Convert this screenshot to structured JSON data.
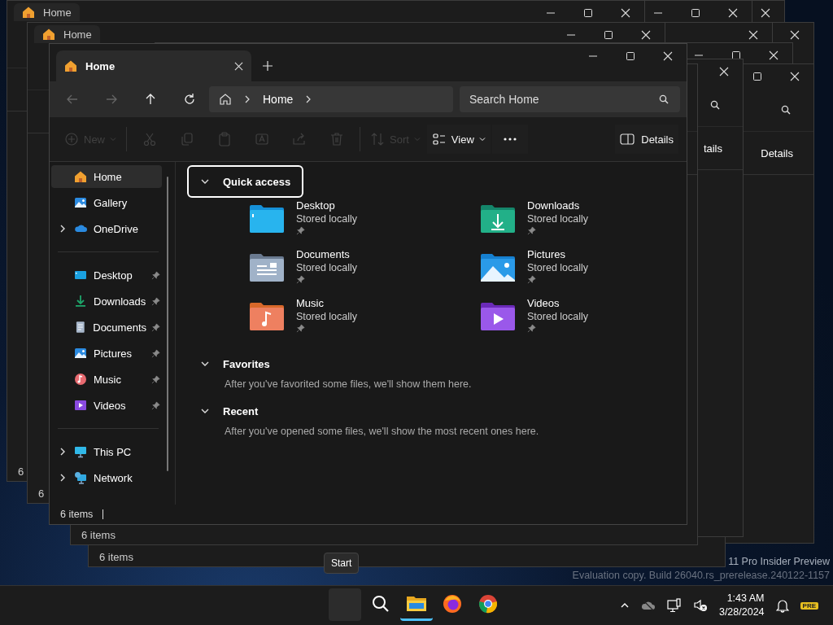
{
  "desktop": {
    "edition_text": "11 Pro Insider Preview",
    "build_text": "Evaluation copy. Build 26040.rs_prerelease.240122-1157"
  },
  "background_windows": [
    {
      "tab_title": "Home",
      "status": "6"
    },
    {
      "tab_title": "Home",
      "status": "6"
    },
    {
      "details": "Details"
    },
    {
      "details": "tails"
    },
    {
      "status": "6 items"
    },
    {
      "status": "6 items"
    }
  ],
  "window": {
    "tab_title": "Home",
    "nav": [
      {
        "kind": "back",
        "disabled": true
      },
      {
        "kind": "forward",
        "disabled": true
      },
      {
        "kind": "up",
        "disabled": false
      },
      {
        "kind": "refresh",
        "disabled": false
      }
    ],
    "address": [
      "Home"
    ],
    "search": {
      "placeholder": "Search Home"
    },
    "commands": [
      {
        "kind": "new",
        "label": "New",
        "disabled": true
      },
      {
        "kind": "cut",
        "disabled": true
      },
      {
        "kind": "copy",
        "disabled": true
      },
      {
        "kind": "paste",
        "disabled": true
      },
      {
        "kind": "rename",
        "disabled": true
      },
      {
        "kind": "share",
        "disabled": true
      },
      {
        "kind": "delete",
        "disabled": true
      },
      {
        "kind": "sort",
        "label": "Sort",
        "disabled": true
      },
      {
        "kind": "view",
        "label": "View",
        "disabled": false
      },
      {
        "kind": "more",
        "disabled": false
      }
    ],
    "details_button": "Details",
    "sidebar": [
      [
        {
          "kind": "home",
          "label": "Home",
          "selected": true
        },
        {
          "kind": "gallery",
          "label": "Gallery",
          "selected": false
        },
        {
          "kind": "onedrive",
          "label": "OneDrive",
          "selected": false,
          "expanded": false
        }
      ],
      [
        {
          "kind": "desktop",
          "label": "Desktop",
          "selected": false,
          "pinned": true
        },
        {
          "kind": "downloads",
          "label": "Downloads",
          "selected": false,
          "pinned": true
        },
        {
          "kind": "documents",
          "label": "Documents",
          "selected": false,
          "pinned": true
        },
        {
          "kind": "pictures",
          "label": "Pictures",
          "selected": false,
          "pinned": true
        },
        {
          "kind": "music",
          "label": "Music",
          "selected": false,
          "pinned": true
        },
        {
          "kind": "videos",
          "label": "Videos",
          "selected": false,
          "pinned": true
        }
      ],
      [
        {
          "kind": "thispc",
          "label": "This PC",
          "selected": false,
          "expanded": false
        },
        {
          "kind": "network",
          "label": "Network",
          "selected": false,
          "expanded": false
        }
      ]
    ],
    "quick_access": {
      "title": "Quick access",
      "expanded": true,
      "focused": true,
      "items": [
        {
          "kind": "desktop",
          "name": "Desktop",
          "location": "Stored locally",
          "pinned": true
        },
        {
          "kind": "downloads",
          "name": "Downloads",
          "location": "Stored locally",
          "pinned": true
        },
        {
          "kind": "documents",
          "name": "Documents",
          "location": "Stored locally",
          "pinned": true
        },
        {
          "kind": "pictures",
          "name": "Pictures",
          "location": "Stored locally",
          "pinned": true
        },
        {
          "kind": "music",
          "name": "Music",
          "location": "Stored locally",
          "pinned": true
        },
        {
          "kind": "videos",
          "name": "Videos",
          "location": "Stored locally",
          "pinned": true
        }
      ]
    },
    "sections": [
      {
        "title": "Favorites",
        "expanded": true,
        "message": "After you've favorited some files, we'll show them here."
      },
      {
        "title": "Recent",
        "expanded": true,
        "message": "After you've opened some files, we'll show the most recent ones here."
      }
    ],
    "status": "6 items"
  },
  "tooltip": "Start",
  "taskbar": {
    "apps": [
      {
        "kind": "start",
        "active": false
      },
      {
        "kind": "search",
        "active": false
      },
      {
        "kind": "explorer",
        "active": true
      },
      {
        "kind": "firefox",
        "active": false
      },
      {
        "kind": "chrome",
        "active": false
      }
    ],
    "time": "1:43 AM",
    "date": "3/28/2024",
    "badge": "PRE"
  }
}
